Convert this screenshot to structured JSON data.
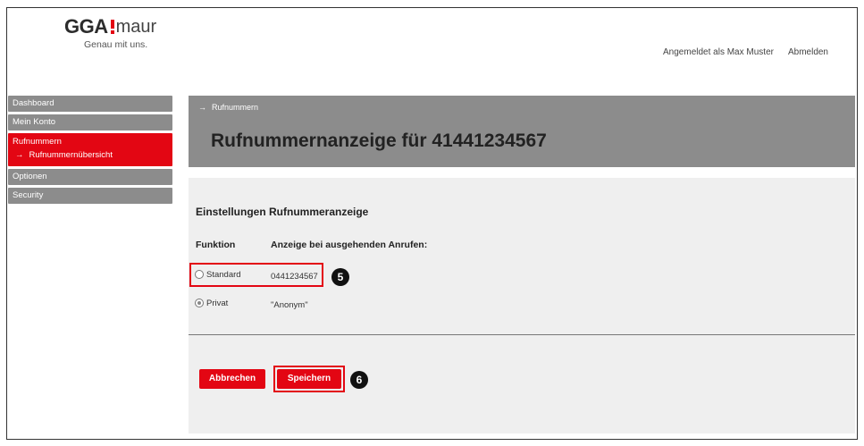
{
  "brand": {
    "logo_text": "GGA",
    "logo_suffix": "maur",
    "tagline": "Genau mit uns."
  },
  "top_nav": {
    "user_text": "Angemeldet als Max Muster",
    "logout_label": "Abmelden"
  },
  "sidebar": {
    "items": [
      {
        "label": "Dashboard"
      },
      {
        "label": "Mein Konto"
      },
      {
        "label": "Rufnummern",
        "sub": "Rufnummernübersicht"
      },
      {
        "label": "Optionen"
      },
      {
        "label": "Security"
      }
    ],
    "arrow": "→"
  },
  "header": {
    "breadcrumb": "Rufnummern",
    "breadcrumb_arrow": "→",
    "title": "Rufnummernanzeige für 41441234567"
  },
  "settings": {
    "section_title": "Einstellungen Rufnummeranzeige",
    "col_function": "Funktion",
    "col_display": "Anzeige bei ausgehenden Anrufen:",
    "options": [
      {
        "label": "Standard",
        "value": "0441234567",
        "checked": false
      },
      {
        "label": "Privat",
        "value": "\"Anonym\"",
        "checked": true
      }
    ]
  },
  "buttons": {
    "cancel_label": "Abbrechen",
    "save_label": "Speichern"
  },
  "annotations": {
    "step5": "5",
    "step6": "6"
  },
  "colors": {
    "accent": "#e30613",
    "gray": "#8c8c8c",
    "panel": "#efefef"
  }
}
